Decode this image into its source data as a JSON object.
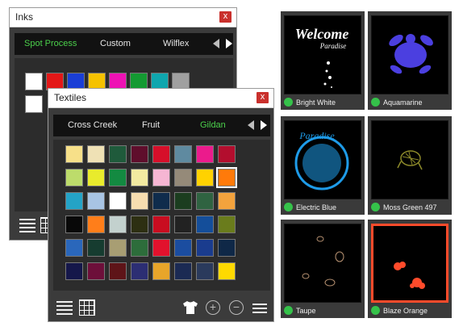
{
  "inks": {
    "title": "Inks",
    "close": "x",
    "tabs": [
      "Spot Process",
      "Custom",
      "Wilflex"
    ],
    "swatches": [
      "#ffffff",
      "#e31717",
      "#1a3ed6",
      "#f5c200",
      "#ee12b4",
      "#149a32",
      "#0fa6ae",
      "#a0a0a0",
      "#ffffff"
    ]
  },
  "textiles": {
    "title": "Textiles",
    "close": "x",
    "tabs": [
      "Cross Creek",
      "Fruit",
      "Gildan"
    ],
    "swatches": [
      [
        "#f7e089",
        "#efe1b5",
        "#1f5a3b",
        "#5f0e2c",
        "#d60f2a",
        "#5f8aa0",
        "#eb1b8c",
        "#b30e2e"
      ],
      [
        "#bddc6b",
        "#e9eb2c",
        "#138a41",
        "#f2eaa1",
        "#f6b6d3",
        "#958a79",
        "#ffd200",
        "#ff7a0a"
      ],
      [
        "#24a3c6",
        "#a8c4e3",
        "#ffffff",
        "#f7ddb0",
        "#0f2c4c",
        "#1b3d1f",
        "#2f6341",
        "#f3a33d"
      ],
      [
        "#080808",
        "#ff7e1a",
        "#c3d1ce",
        "#2d2f12",
        "#c90d20",
        "#222222",
        "#144e9a",
        "#6a7c1c"
      ],
      [
        "#2a67bb",
        "#163c30",
        "#a89e73",
        "#2d6d3b",
        "#e2122d",
        "#1b4da0",
        "#1a3c8e",
        "#0f2847"
      ],
      [
        "#15174a",
        "#6d0f3a",
        "#5e1418",
        "#2c2e73",
        "#e8a52a",
        "#1b2a53",
        "#2a3a5c",
        "#ffd900"
      ]
    ],
    "selected": [
      1,
      7
    ]
  },
  "gallery": [
    {
      "name": "Bright White",
      "artText": "Welcome",
      "artSub": "Paradise",
      "color": "#ffffff",
      "selected": false
    },
    {
      "name": "Aquamarine",
      "color": "#4b3fe0",
      "selected": false
    },
    {
      "name": "Electric Blue",
      "artText": "Paradise",
      "color": "#1e9be8",
      "selected": false
    },
    {
      "name": "Moss Green 497",
      "color": "#8d8a2a",
      "selected": false
    },
    {
      "name": "Taupe",
      "color": "#b59070",
      "selected": false
    },
    {
      "name": "Blaze Orange",
      "color": "#ff4b2b",
      "selected": true
    }
  ]
}
